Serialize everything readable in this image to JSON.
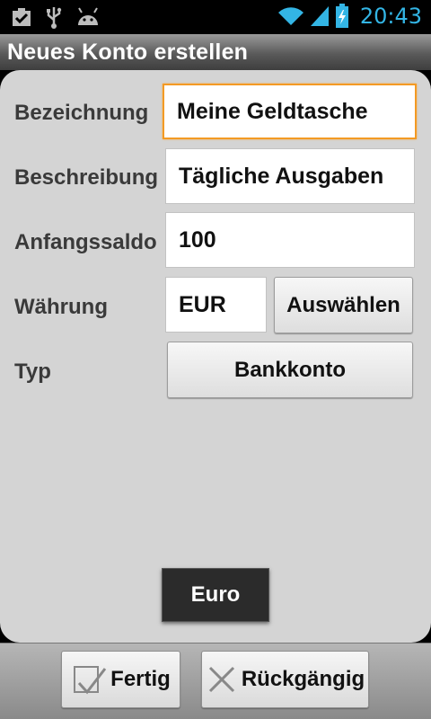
{
  "status_bar": {
    "time": "20:43",
    "left_icons": [
      "task-check-icon",
      "usb-icon",
      "android-icon"
    ],
    "right_icons": [
      "wifi-icon",
      "signal-icon",
      "battery-charging-icon"
    ],
    "accent_color": "#33b5e5"
  },
  "title_bar": {
    "title": "Neues Konto erstellen"
  },
  "form": {
    "name_label": "Bezeichnung",
    "name_value": "Meine Geldtasche",
    "description_label": "Beschreibung",
    "description_value": "Tägliche Ausgaben",
    "balance_label": "Anfangssaldo",
    "balance_value": "100",
    "currency_label": "Währung",
    "currency_value": "EUR",
    "currency_select_label": "Auswählen",
    "type_label": "Typ",
    "type_value": "Bankkonto",
    "focus_color": "#f39a24"
  },
  "toast": {
    "text": "Euro"
  },
  "bottom_bar": {
    "done_label": "Fertig",
    "revert_label": "Rückgängig"
  }
}
